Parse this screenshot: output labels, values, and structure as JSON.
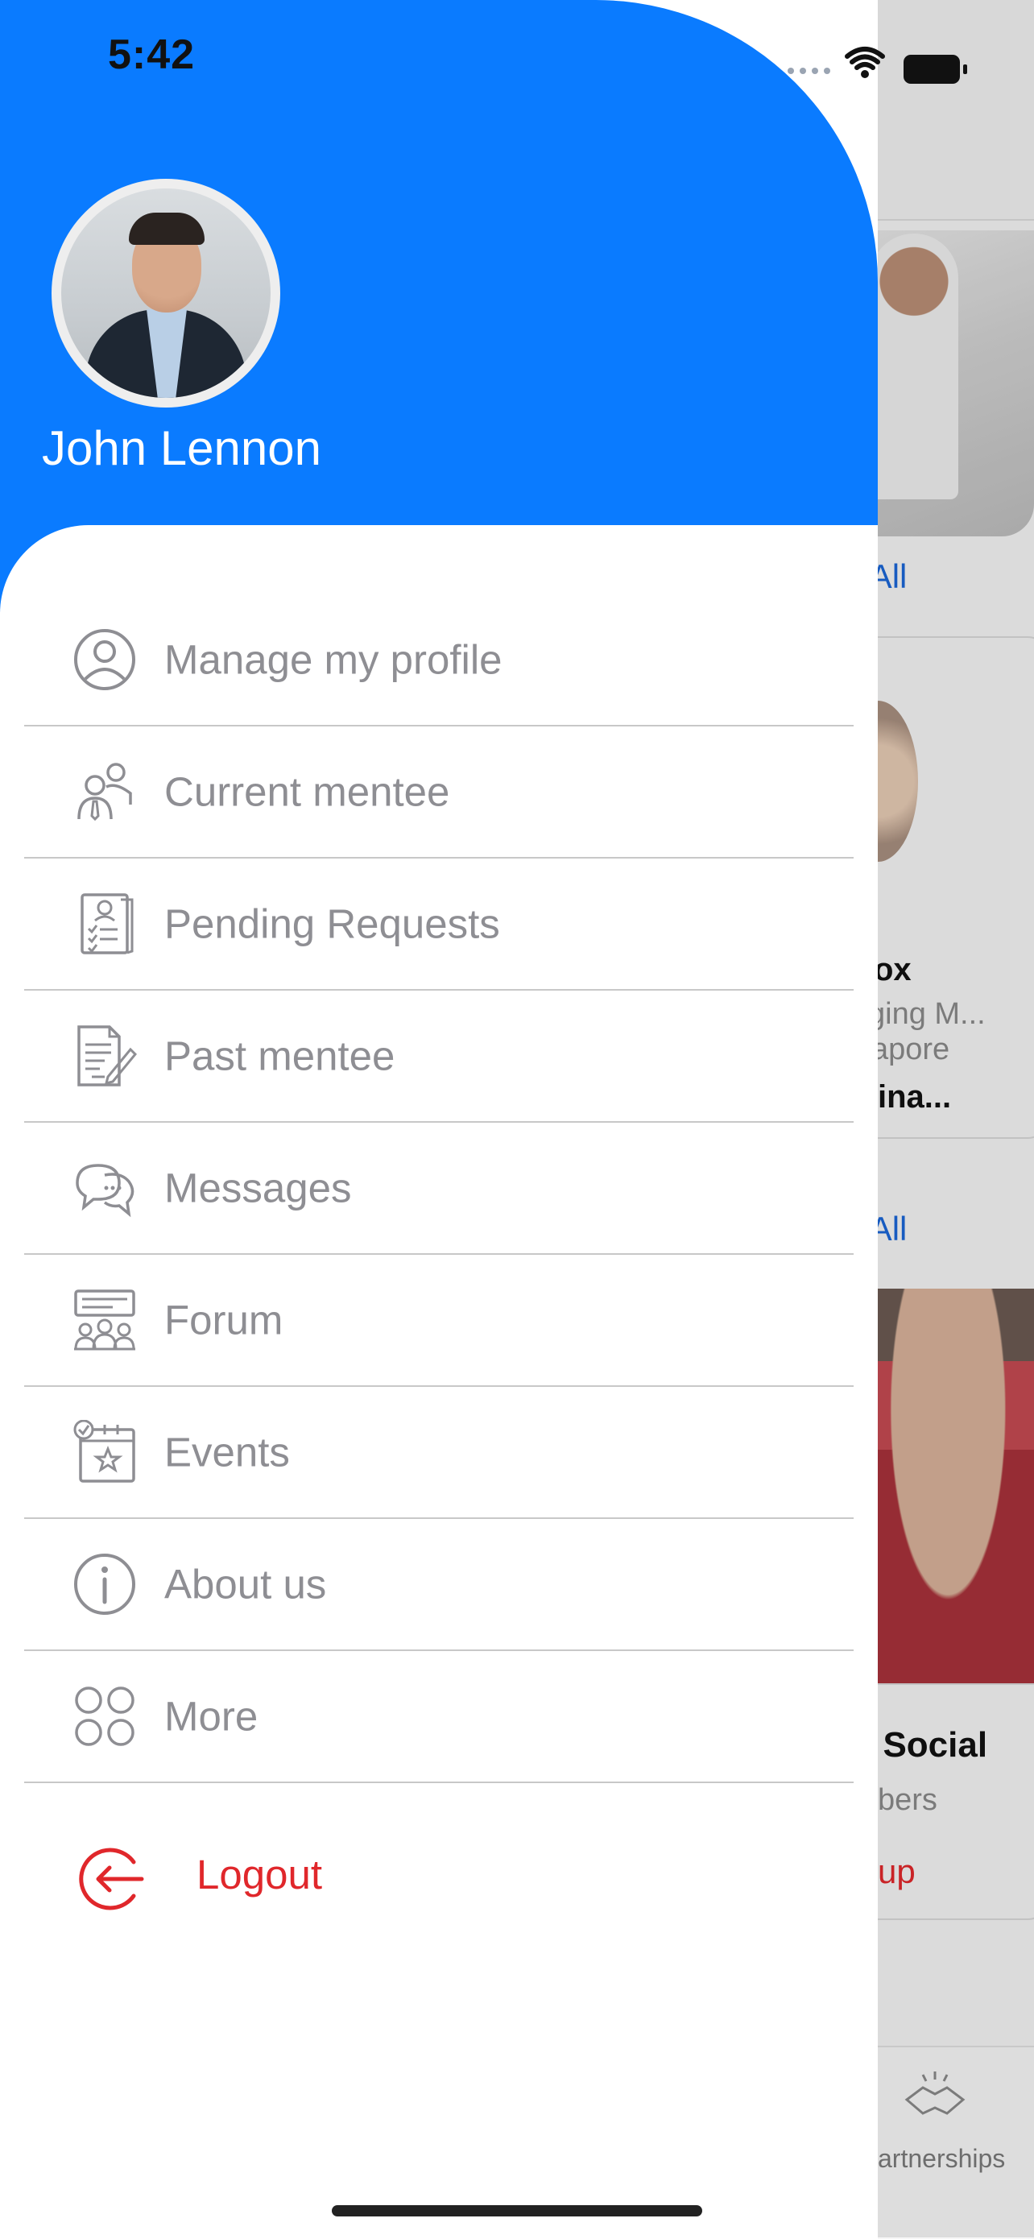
{
  "status_bar": {
    "time": "5:42"
  },
  "drawer": {
    "user_name": "John Lennon",
    "menu": [
      {
        "label": "Manage my profile",
        "icon": "profile-icon"
      },
      {
        "label": "Current mentee",
        "icon": "mentee-icon"
      },
      {
        "label": "Pending Requests",
        "icon": "requests-icon"
      },
      {
        "label": "Past mentee",
        "icon": "document-edit-icon"
      },
      {
        "label": "Messages",
        "icon": "chat-icon"
      },
      {
        "label": "Forum",
        "icon": "forum-icon"
      },
      {
        "label": "Events",
        "icon": "calendar-icon"
      },
      {
        "label": "About us",
        "icon": "info-icon"
      },
      {
        "label": "More",
        "icon": "grid-icon"
      }
    ],
    "logout": {
      "label": "Logout",
      "icon": "logout-icon"
    }
  },
  "background": {
    "view_all_1": "w All",
    "card_name": "ox",
    "card_role": "ging M...",
    "card_location": "apore",
    "card_extra": "ina...",
    "view_all_2": "w All",
    "group_title": "/ Social",
    "group_members": "bers",
    "group_action": "up",
    "tab_label": "artnerships"
  },
  "colors": {
    "header_blue": "#0a7bff",
    "logout_red": "#e0272b",
    "menu_text": "#8e8e93"
  }
}
